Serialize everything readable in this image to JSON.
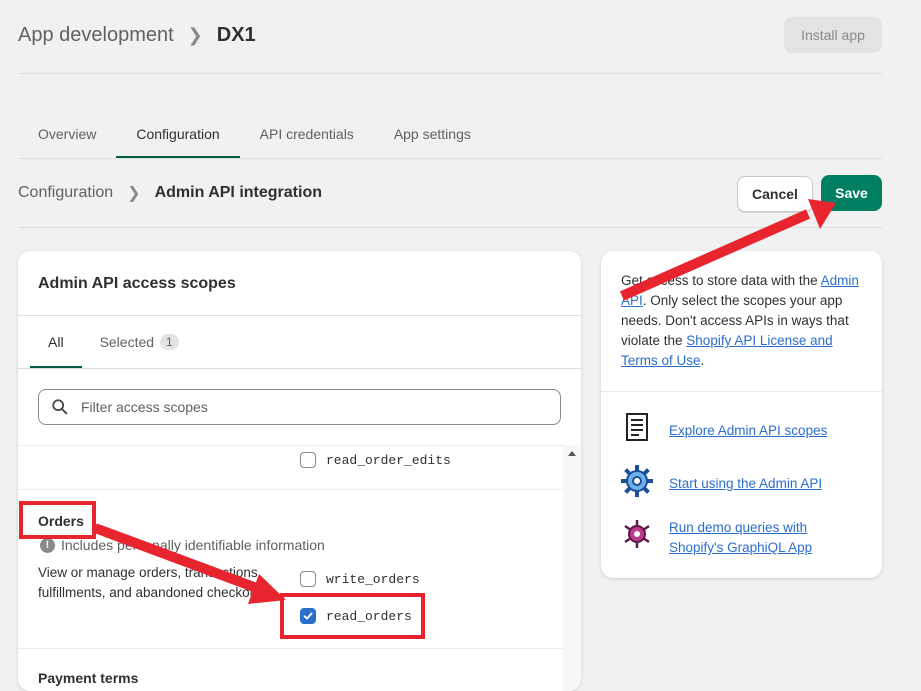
{
  "header": {
    "breadcrumb_parent": "App development",
    "breadcrumb_current": "DX1",
    "install_label": "Install app"
  },
  "tabs": [
    {
      "label": "Overview",
      "active": false
    },
    {
      "label": "Configuration",
      "active": true
    },
    {
      "label": "API credentials",
      "active": false
    },
    {
      "label": "App settings",
      "active": false
    }
  ],
  "subheader": {
    "parent": "Configuration",
    "current": "Admin API integration",
    "cancel_label": "Cancel",
    "save_label": "Save"
  },
  "scopes_card": {
    "title": "Admin API access scopes",
    "tabs": [
      {
        "label": "All",
        "active": true
      },
      {
        "label": "Selected",
        "count": "1",
        "active": false
      }
    ],
    "search_placeholder": "Filter access scopes",
    "prev_scope": {
      "name": "read_order_edits",
      "checked": false
    },
    "orders": {
      "title": "Orders",
      "pii_note": "Includes personally identifiable information",
      "description_line1": "View or manage orders, transactions,",
      "description_line2": "fulfillments, and abandoned checkouts",
      "scopes": [
        {
          "name": "write_orders",
          "checked": false
        },
        {
          "name": "read_orders",
          "checked": true
        }
      ]
    },
    "next_section_title": "Payment terms"
  },
  "side_card": {
    "intro_prefix": "Get access to store data with the ",
    "intro_link1": "Admin API",
    "intro_mid": ". Only select the scopes your app needs. Don't access APIs in ways that violate the ",
    "intro_link2": "Shopify API License and Terms of Use",
    "intro_suffix": ".",
    "links": [
      {
        "label": "Explore Admin API scopes",
        "icon": "scroll-document-icon"
      },
      {
        "label": "Start using the Admin API",
        "icon": "gear-icon"
      },
      {
        "label": "Run demo queries with Shopify's GraphiQL App",
        "icon": "graphql-bug-icon"
      }
    ]
  },
  "colors": {
    "accent": "#008060",
    "tab_underline": "#005e46",
    "checkbox": "#2c6ecb",
    "annotation_red": "#e8252f"
  }
}
